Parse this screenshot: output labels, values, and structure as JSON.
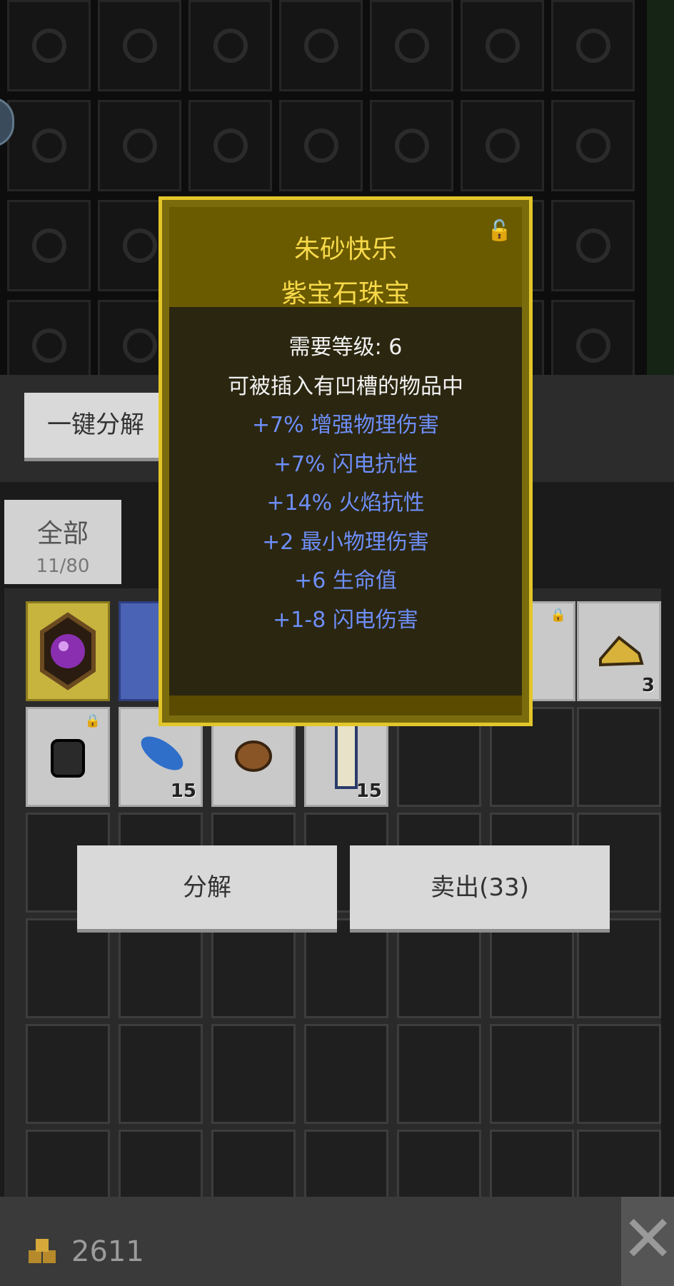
{
  "top_grid": {
    "note_cells": 28
  },
  "toolbar": {
    "one_click_dismantle": "一键分解"
  },
  "tabs": {
    "all_label": "全部",
    "all_count": "11/80"
  },
  "tooltip": {
    "name": "朱砂快乐",
    "type": "紫宝石珠宝",
    "required_level": "需要等级: 6",
    "socket_text": "可被插入有凹槽的物品中",
    "stats": [
      "+7% 增强物理伤害",
      "+7% 闪电抗性",
      "+14% 火焰抗性",
      "+2 最小物理伤害",
      "+6 生命值",
      "+1-8 闪电伤害"
    ],
    "colors": {
      "title": "#f7d94a",
      "stat": "#6d8ef7",
      "border": "#e2c62a"
    }
  },
  "inventory": {
    "counts": {
      "item7": "3",
      "item9": "15",
      "item11": "15"
    }
  },
  "actions": {
    "dismantle": "分解",
    "sell": "卖出(33)"
  },
  "footer": {
    "gold": "2611",
    "close_icon": "close-icon"
  }
}
